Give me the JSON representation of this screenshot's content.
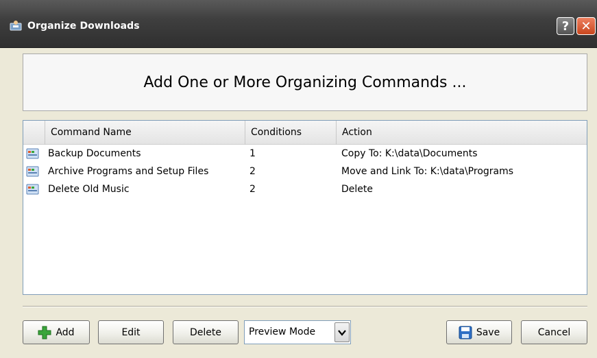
{
  "window": {
    "title": "Organize Downloads",
    "help_label": "?",
    "close_label": "✕"
  },
  "header": {
    "heading": "Add One or More Organizing Commands ..."
  },
  "table": {
    "columns": [
      "Command Name",
      "Conditions",
      "Action"
    ],
    "rows": [
      {
        "name": "Backup Documents",
        "conditions": "1",
        "action": "Copy To: K:\\data\\Documents",
        "icon": "command-icon"
      },
      {
        "name": "Archive Programs and Setup Files",
        "conditions": "2",
        "action": "Move and Link To: K:\\data\\Programs",
        "icon": "command-icon"
      },
      {
        "name": "Delete Old Music",
        "conditions": "2",
        "action": "Delete",
        "icon": "command-icon"
      }
    ]
  },
  "toolbar": {
    "add_label": "Add",
    "edit_label": "Edit",
    "delete_label": "Delete",
    "mode_selected": "Preview Mode",
    "save_label": "Save",
    "cancel_label": "Cancel"
  },
  "colors": {
    "titlebar": "#3f3f3f",
    "dialog_bg": "#ece9d8",
    "add_icon_green": "#3aa53a",
    "save_icon_blue": "#2f6fc4"
  }
}
